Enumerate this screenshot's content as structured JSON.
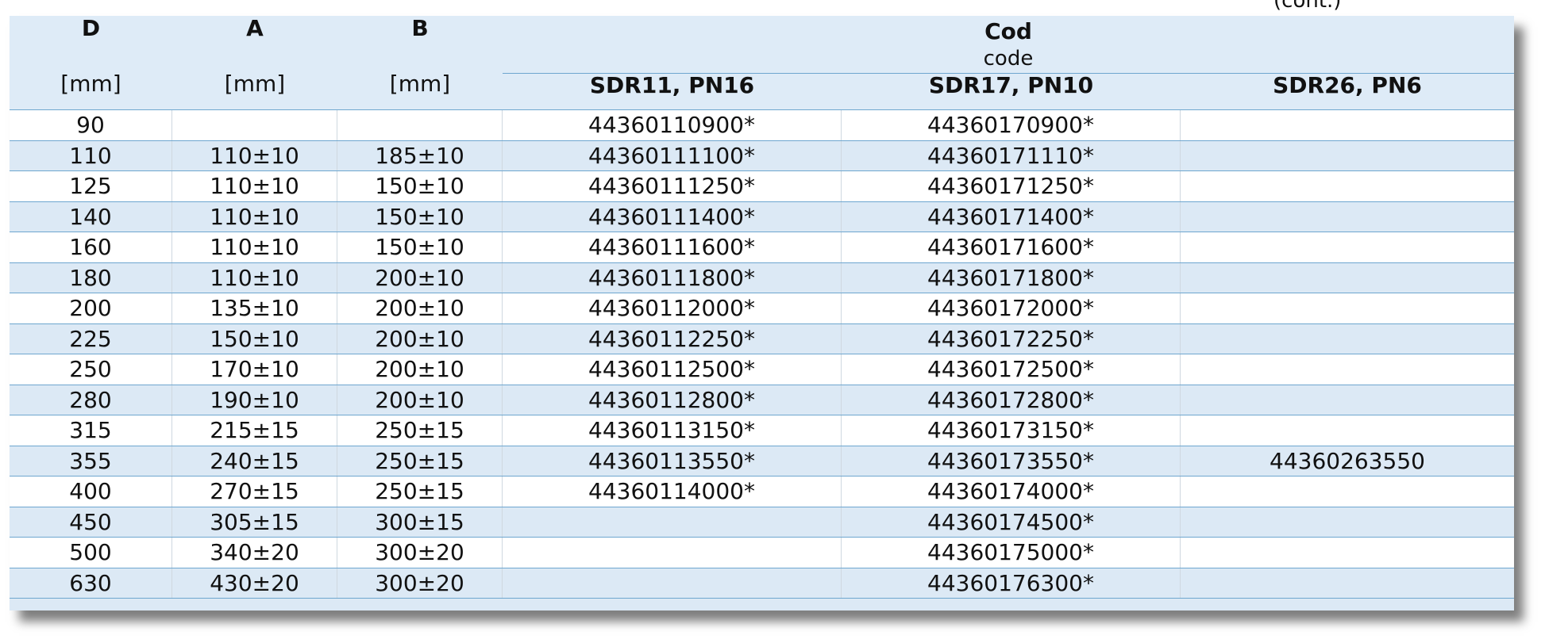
{
  "top_corner_text": "(cont.)",
  "header": {
    "d_label": "D",
    "d_unit": "[mm]",
    "a_label": "A",
    "a_unit": "[mm]",
    "b_label": "B",
    "b_unit": "[mm]",
    "code_label": "Cod",
    "code_sublabel": "code",
    "sdr11": "SDR11, PN16",
    "sdr17": "SDR17, PN10",
    "sdr26": "SDR26, PN6"
  },
  "rows": [
    {
      "d": "90",
      "a": "",
      "b": "",
      "sdr11": "44360110900*",
      "sdr17": "44360170900*",
      "sdr26": ""
    },
    {
      "d": "110",
      "a": "110±10",
      "b": "185±10",
      "sdr11": "44360111100*",
      "sdr17": "44360171110*",
      "sdr26": ""
    },
    {
      "d": "125",
      "a": "110±10",
      "b": "150±10",
      "sdr11": "44360111250*",
      "sdr17": "44360171250*",
      "sdr26": ""
    },
    {
      "d": "140",
      "a": "110±10",
      "b": "150±10",
      "sdr11": "44360111400*",
      "sdr17": "44360171400*",
      "sdr26": ""
    },
    {
      "d": "160",
      "a": "110±10",
      "b": "150±10",
      "sdr11": "44360111600*",
      "sdr17": "44360171600*",
      "sdr26": ""
    },
    {
      "d": "180",
      "a": "110±10",
      "b": "200±10",
      "sdr11": "44360111800*",
      "sdr17": "44360171800*",
      "sdr26": ""
    },
    {
      "d": "200",
      "a": "135±10",
      "b": "200±10",
      "sdr11": "44360112000*",
      "sdr17": "44360172000*",
      "sdr26": ""
    },
    {
      "d": "225",
      "a": "150±10",
      "b": "200±10",
      "sdr11": "44360112250*",
      "sdr17": "44360172250*",
      "sdr26": ""
    },
    {
      "d": "250",
      "a": "170±10",
      "b": "200±10",
      "sdr11": "44360112500*",
      "sdr17": "44360172500*",
      "sdr26": ""
    },
    {
      "d": "280",
      "a": "190±10",
      "b": "200±10",
      "sdr11": "44360112800*",
      "sdr17": "44360172800*",
      "sdr26": ""
    },
    {
      "d": "315",
      "a": "215±15",
      "b": "250±15",
      "sdr11": "44360113150*",
      "sdr17": "44360173150*",
      "sdr26": ""
    },
    {
      "d": "355",
      "a": "240±15",
      "b": "250±15",
      "sdr11": "44360113550*",
      "sdr17": "44360173550*",
      "sdr26": "44360263550"
    },
    {
      "d": "400",
      "a": "270±15",
      "b": "250±15",
      "sdr11": "44360114000*",
      "sdr17": "44360174000*",
      "sdr26": ""
    },
    {
      "d": "450",
      "a": "305±15",
      "b": "300±15",
      "sdr11": "",
      "sdr17": "44360174500*",
      "sdr26": ""
    },
    {
      "d": "500",
      "a": "340±20",
      "b": "300±20",
      "sdr11": "",
      "sdr17": "44360175000*",
      "sdr26": ""
    },
    {
      "d": "630",
      "a": "430±20",
      "b": "300±20",
      "sdr11": "",
      "sdr17": "44360176300*",
      "sdr26": ""
    }
  ]
}
